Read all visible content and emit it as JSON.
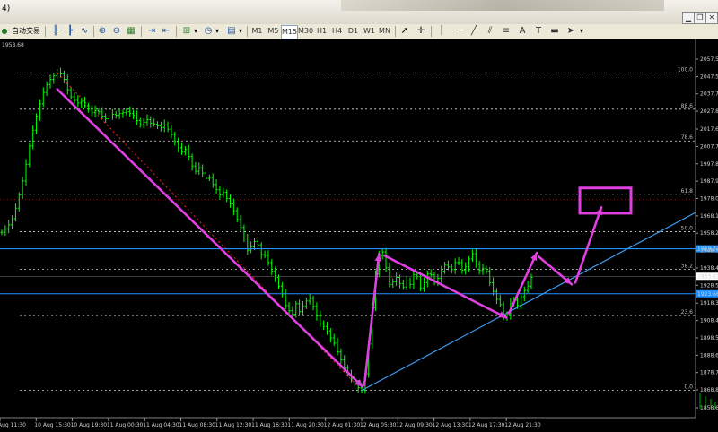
{
  "window": {
    "title": "4)"
  },
  "toolbar": {
    "autotrade_label": "自动交易",
    "timeframes": [
      "M1",
      "M5",
      "M15",
      "M30",
      "H1",
      "H4",
      "D1",
      "W1",
      "MN"
    ],
    "active_timeframe": "M15",
    "icons": [
      "bar-chart-icon",
      "candles-icon",
      "line-chart-icon",
      "zoom-in-icon",
      "zoom-out-icon",
      "tile-windows-icon",
      "autoscroll-icon",
      "chart-shift-icon",
      "indicators-icon",
      "periods-icon",
      "templates-icon",
      "cursor-icon",
      "crosshair-icon",
      "vertical-line-icon",
      "horizontal-line-icon",
      "trendline-icon",
      "channel-icon",
      "fibonacci-icon",
      "text-icon",
      "label-icon",
      "rectangle-icon",
      "arrow-icon"
    ]
  },
  "chart": {
    "top_left_price": "1958.68",
    "price_axis": [
      "2057.50",
      "2047.50",
      "2037.70",
      "2027.80",
      "2017.60",
      "2007.70",
      "1997.80",
      "1987.90",
      "1978.00",
      "1968.10",
      "1958.20",
      "1948.30",
      "1938.40",
      "1928.50",
      "1918.30",
      "1908.40",
      "1898.50",
      "1888.60",
      "1878.70",
      "1868.80",
      "1858.60"
    ],
    "current_price": "1933.63",
    "hline_upper": "1949.32",
    "hline_lower": "1923.66",
    "fib_levels": [
      "100.0",
      "88.6",
      "78.6",
      "61.8",
      "50.0",
      "38.2",
      "23.6",
      "0.0"
    ],
    "time_axis": [
      "Aug 11:30",
      "10 Aug 15:30",
      "10 Aug 19:30",
      "11 Aug 00:30",
      "11 Aug 04:30",
      "11 Aug 08:30",
      "11 Aug 12:30",
      "11 Aug 16:30",
      "11 Aug 20:30",
      "12 Aug 01:30",
      "12 Aug 05:30",
      "12 Aug 09:30",
      "12 Aug 13:30",
      "12 Aug 17:30",
      "12 Aug 21:30"
    ],
    "colors": {
      "candle": "#00ff00",
      "annotation": "#e040e0",
      "hline": "#1e90ff",
      "trendline": "#3c9bf0",
      "fib_dotted": "#ffffff",
      "red_trend": "#ff2020",
      "background": "#000000"
    },
    "price_series": [
      1958.7,
      1960.5,
      1963.0,
      1966.5,
      1972.5,
      1980.0,
      1988.0,
      1997.5,
      2008.0,
      2017.0,
      2025.0,
      2032.0,
      2038.5,
      2043.0,
      2046.0,
      2048.0,
      2049.6,
      2049.0,
      2046.0,
      2040.0,
      2036.0,
      2034.0,
      2032.5,
      2033.5,
      2031.0,
      2029.0,
      2027.0,
      2028.0,
      2027.5,
      2025.0,
      2023.5,
      2024.5,
      2026.0,
      2025.5,
      2026.5,
      2027.0,
      2027.5,
      2026.5,
      2025.5,
      2022.5,
      2020.0,
      2021.5,
      2023.0,
      2021.0,
      2020.5,
      2019.5,
      2018.5,
      2020.0,
      2017.5,
      2014.5,
      2010.5,
      2007.0,
      2004.5,
      2006.0,
      2002.0,
      1996.5,
      1993.5,
      1995.5,
      1992.5,
      1989.5,
      1990.0,
      1986.0,
      1983.0,
      1980.0,
      1981.5,
      1978.0,
      1975.0,
      1971.0,
      1966.0,
      1961.5,
      1955.5,
      1948.5,
      1950.5,
      1953.5,
      1951.5,
      1946.0,
      1945.5,
      1941.5,
      1936.5,
      1933.0,
      1928.0,
      1923.5,
      1917.0,
      1914.0,
      1912.0,
      1918.0,
      1913.5,
      1916.5,
      1919.5,
      1921.0,
      1916.5,
      1911.0,
      1906.5,
      1905.0,
      1902.5,
      1898.5,
      1895.5,
      1890.5,
      1886.0,
      1881.5,
      1878.0,
      1875.0,
      1872.5,
      1870.0,
      1868.5,
      1878.0,
      1895.0,
      1915.5,
      1935.0,
      1945.5,
      1947.5,
      1938.5,
      1929.0,
      1930.5,
      1933.0,
      1929.5,
      1927.5,
      1931.0,
      1929.0,
      1934.5,
      1933.5,
      1927.0,
      1930.0,
      1935.0,
      1934.5,
      1930.5,
      1932.5,
      1936.5,
      1940.0,
      1939.0,
      1937.5,
      1941.5,
      1941.5,
      1937.0,
      1939.0,
      1943.5,
      1946.5,
      1940.5,
      1937.0,
      1938.0,
      1936.5,
      1930.0,
      1925.0,
      1920.5,
      1917.5,
      1910.5,
      1911.5,
      1918.0,
      1920.0,
      1917.0,
      1922.0,
      1925.5,
      1928.0,
      1933.0
    ],
    "rectangle_label": ""
  }
}
